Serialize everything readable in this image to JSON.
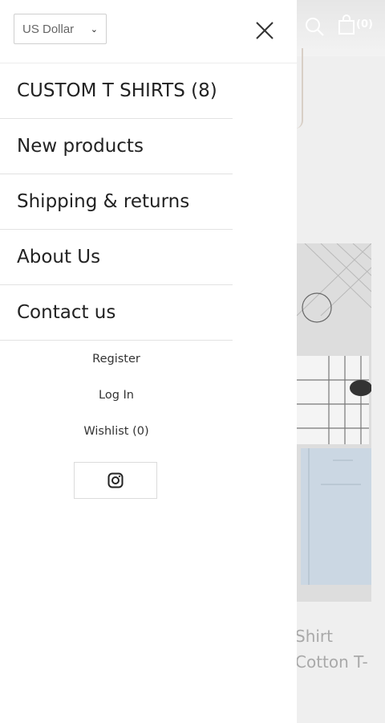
{
  "currency": {
    "selected": "US Dollar"
  },
  "menu": {
    "items": [
      {
        "label": "CUSTOM T SHIRTS (8)"
      },
      {
        "label": "New products"
      },
      {
        "label": "Shipping & returns"
      },
      {
        "label": "About Us"
      },
      {
        "label": "Contact us"
      }
    ]
  },
  "account_links": {
    "register": "Register",
    "login": "Log In",
    "wishlist": "Wishlist (0)"
  },
  "social": {
    "icon": "instagram-icon"
  },
  "background": {
    "cart_count": "(0)",
    "product_text_line1": "Shirt",
    "product_text_line2": "Cotton T-"
  }
}
